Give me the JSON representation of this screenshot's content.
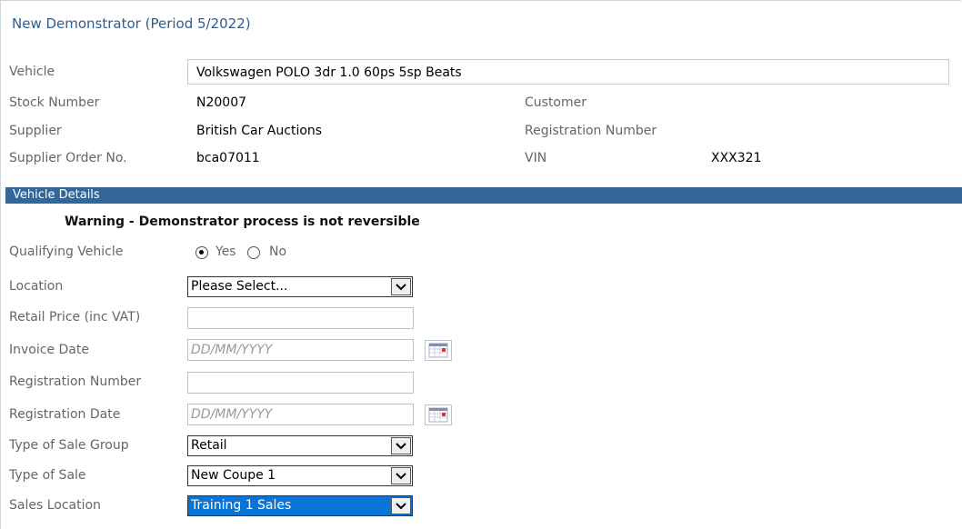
{
  "header": {
    "title": "New Demonstrator (Period  5/2022)"
  },
  "vehicle": {
    "label": "Vehicle",
    "value": "Volkswagen POLO 3dr 1.0 60ps 5sp Beats"
  },
  "info": {
    "stock_label": "Stock Number",
    "stock_value": "N20007",
    "supplier_label": "Supplier",
    "supplier_value": "British Car Auctions",
    "order_label": "Supplier Order No.",
    "order_value": "bca07011",
    "customer_label": "Customer",
    "reg_label": "Registration Number",
    "vin_label": "VIN",
    "vin_value": "XXX321"
  },
  "section": {
    "title": "Vehicle Details"
  },
  "warning": "Warning - Demonstrator process is not reversible",
  "form": {
    "qualifying_label": "Qualifying Vehicle",
    "qualifying_options": [
      "Yes",
      "No"
    ],
    "qualifying_selected": "Yes",
    "location_label": "Location",
    "location_value": "Please Select...",
    "retail_label": "Retail Price (inc VAT)",
    "retail_value": "",
    "invoice_label": "Invoice Date",
    "invoice_placeholder": "DD/MM/YYYY",
    "regnum_label": "Registration Number",
    "regnum_value": "",
    "regdate_label": "Registration Date",
    "regdate_placeholder": "DD/MM/YYYY",
    "salegroup_label": "Type of Sale Group",
    "salegroup_value": "Retail",
    "saletype_label": "Type of Sale",
    "saletype_value": "New Coupe 1",
    "saleloc_label": "Sales Location",
    "saleloc_value": "Training 1 Sales"
  },
  "colors": {
    "accent": "#336699",
    "title": "#2f5d8c",
    "selected": "#0a74d6"
  }
}
